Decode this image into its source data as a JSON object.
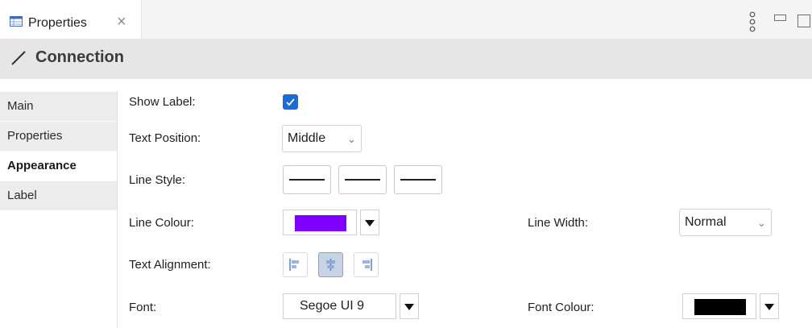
{
  "tabbar": {
    "tab_label": "Properties",
    "close_glyph": "×",
    "icons": [
      "table-icon",
      "view-menu-icon",
      "minimize-icon",
      "maximize-icon"
    ]
  },
  "header": {
    "icon": "connection-line-icon",
    "title": "Connection"
  },
  "sidebar": {
    "items": [
      {
        "label": "Main",
        "active": false
      },
      {
        "label": "Properties",
        "active": false
      },
      {
        "label": "Appearance",
        "active": true
      },
      {
        "label": "Label",
        "active": false
      }
    ]
  },
  "form": {
    "show_label": {
      "label": "Show Label:",
      "checked": true
    },
    "text_position": {
      "label": "Text Position:",
      "value": "Middle"
    },
    "line_style": {
      "label": "Line Style:",
      "options": [
        "solid",
        "solid",
        "solid"
      ]
    },
    "line_colour": {
      "label": "Line Colour:",
      "color": "#8000ff"
    },
    "line_width": {
      "label": "Line Width:",
      "value": "Normal"
    },
    "text_alignment": {
      "label": "Text Alignment:",
      "options": [
        "left",
        "center",
        "right"
      ],
      "selected": "center"
    },
    "font": {
      "label": "Font:",
      "value": "Segoe UI 9"
    },
    "font_colour": {
      "label": "Font Colour:",
      "color": "#000000"
    }
  },
  "colors": {
    "accent": "#1c6bd6",
    "header_bg": "#e6e6e6",
    "sidebar_bg": "#ececec"
  }
}
